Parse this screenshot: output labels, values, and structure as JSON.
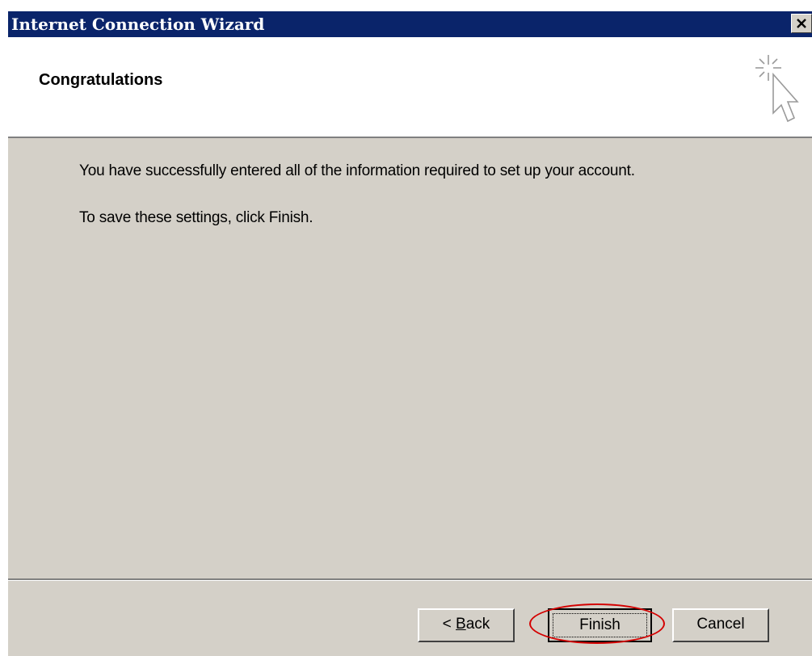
{
  "window": {
    "title": "Internet Connection Wizard",
    "close_glyph": "✕"
  },
  "header": {
    "title": "Congratulations",
    "icon": "wizard-cursor-sparkle-icon"
  },
  "content": {
    "line1": "You have successfully entered all of the information required to set up your account.",
    "line2": "To save these settings, click Finish."
  },
  "buttons": {
    "back_prefix": "< ",
    "back_mnemonic": "B",
    "back_rest": "ack",
    "finish": "Finish",
    "cancel": "Cancel"
  },
  "annotation": {
    "highlight_color": "#d40000",
    "target": "finish-button"
  },
  "colors": {
    "titlebar": "#0a246a",
    "face": "#d4d0c8",
    "header_bg": "#ffffff"
  }
}
